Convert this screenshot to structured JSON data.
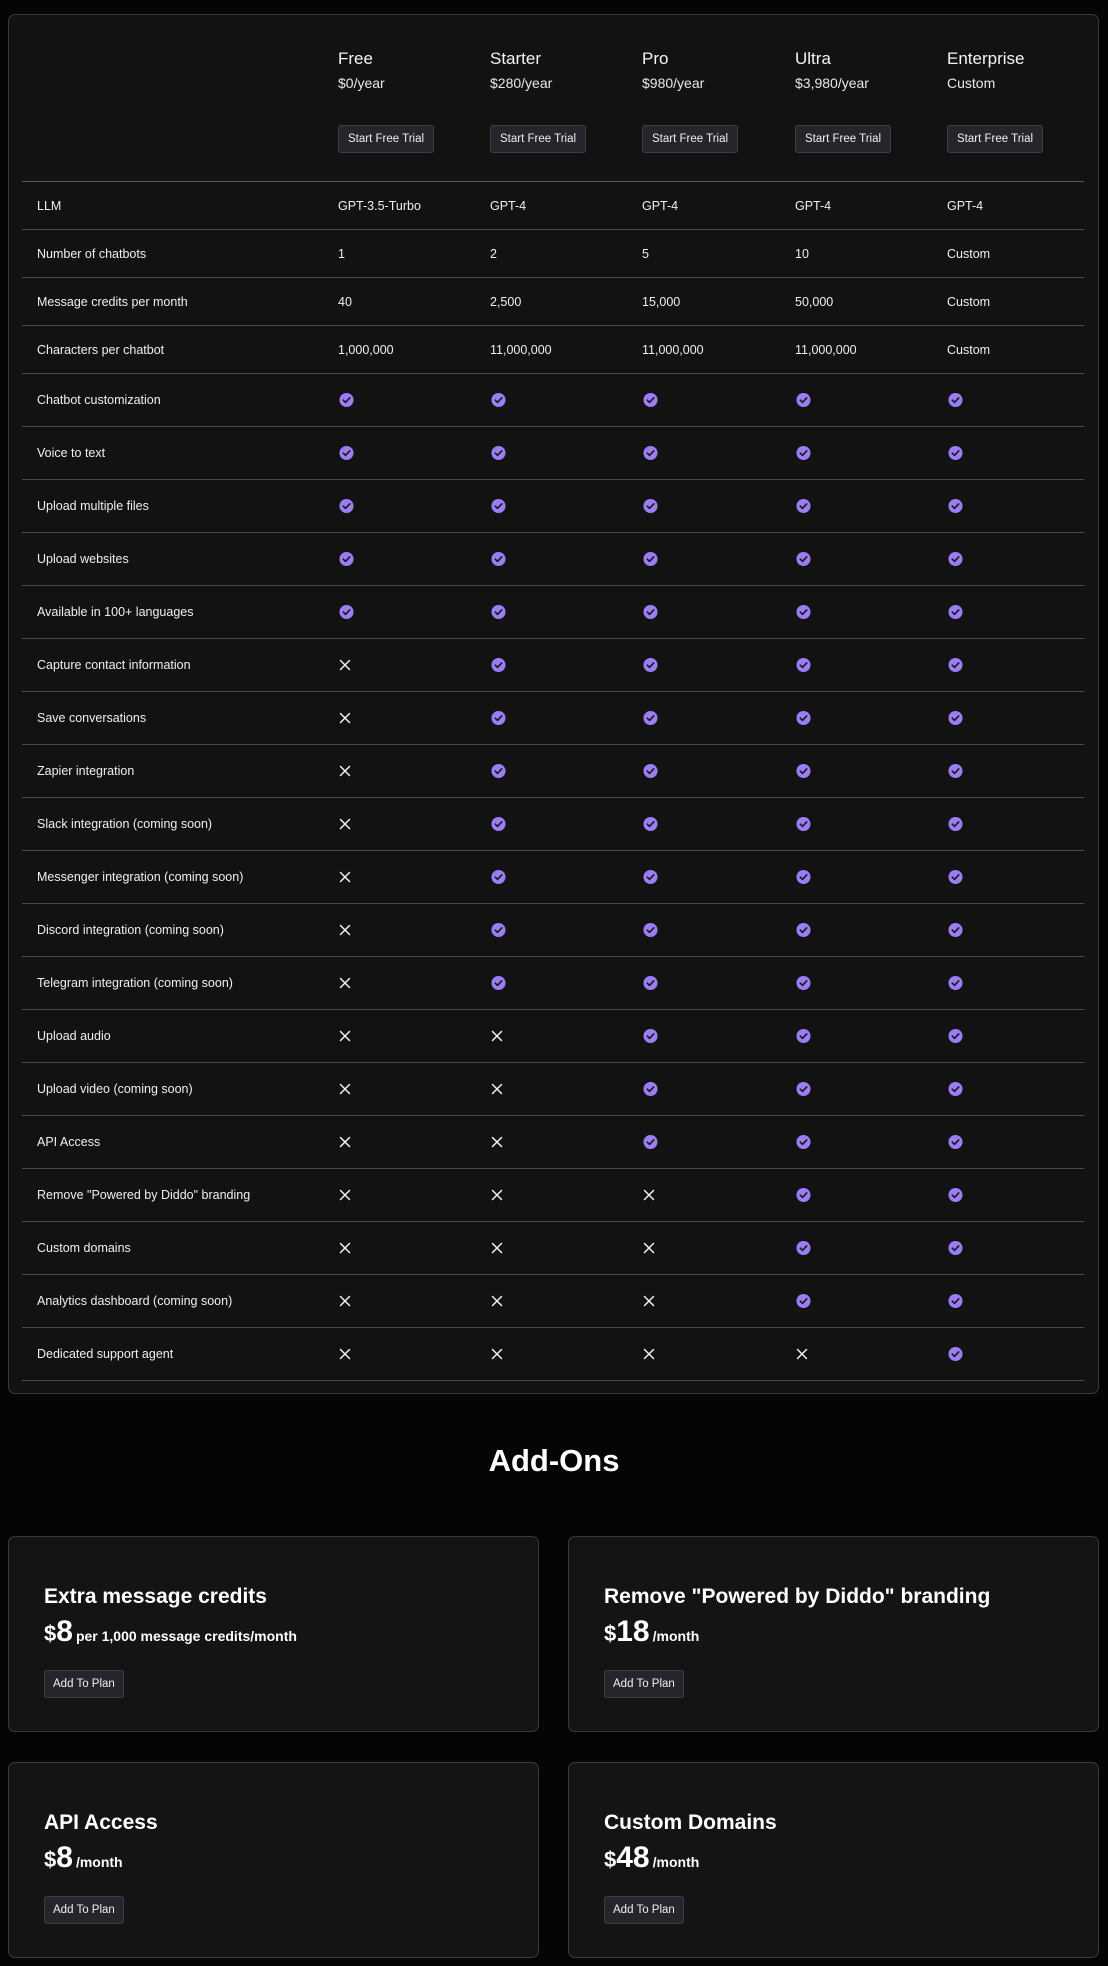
{
  "colors": {
    "check": "#9b7ef5",
    "background": "#050505",
    "card": "#121212"
  },
  "plans": [
    {
      "name": "Free",
      "price": "$0/year",
      "cta": "Start Free Trial"
    },
    {
      "name": "Starter",
      "price": "$280/year",
      "cta": "Start Free Trial"
    },
    {
      "name": "Pro",
      "price": "$980/year",
      "cta": "Start Free Trial"
    },
    {
      "name": "Ultra",
      "price": "$3,980/year",
      "cta": "Start Free Trial"
    },
    {
      "name": "Enterprise",
      "price": "Custom",
      "cta": "Start Free Trial"
    }
  ],
  "features": [
    {
      "label": "LLM",
      "values": [
        "GPT-3.5-Turbo",
        "GPT-4",
        "GPT-4",
        "GPT-4",
        "GPT-4"
      ]
    },
    {
      "label": "Number of chatbots",
      "values": [
        "1",
        "2",
        "5",
        "10",
        "Custom"
      ]
    },
    {
      "label": "Message credits per month",
      "values": [
        "40",
        "2,500",
        "15,000",
        "50,000",
        "Custom"
      ]
    },
    {
      "label": "Characters per chatbot",
      "values": [
        "1,000,000",
        "11,000,000",
        "11,000,000",
        "11,000,000",
        "Custom"
      ]
    },
    {
      "label": "Chatbot customization",
      "values": [
        true,
        true,
        true,
        true,
        true
      ]
    },
    {
      "label": "Voice to text",
      "values": [
        true,
        true,
        true,
        true,
        true
      ]
    },
    {
      "label": "Upload multiple files",
      "values": [
        true,
        true,
        true,
        true,
        true
      ]
    },
    {
      "label": "Upload websites",
      "values": [
        true,
        true,
        true,
        true,
        true
      ]
    },
    {
      "label": "Available in 100+ languages",
      "values": [
        true,
        true,
        true,
        true,
        true
      ]
    },
    {
      "label": "Capture contact information",
      "values": [
        false,
        true,
        true,
        true,
        true
      ]
    },
    {
      "label": "Save conversations",
      "values": [
        false,
        true,
        true,
        true,
        true
      ]
    },
    {
      "label": "Zapier integration",
      "values": [
        false,
        true,
        true,
        true,
        true
      ]
    },
    {
      "label": "Slack integration (coming soon)",
      "values": [
        false,
        true,
        true,
        true,
        true
      ]
    },
    {
      "label": "Messenger integration (coming soon)",
      "values": [
        false,
        true,
        true,
        true,
        true
      ]
    },
    {
      "label": "Discord integration (coming soon)",
      "values": [
        false,
        true,
        true,
        true,
        true
      ]
    },
    {
      "label": "Telegram integration (coming soon)",
      "values": [
        false,
        true,
        true,
        true,
        true
      ]
    },
    {
      "label": "Upload audio",
      "values": [
        false,
        false,
        true,
        true,
        true
      ]
    },
    {
      "label": "Upload video (coming soon)",
      "values": [
        false,
        false,
        true,
        true,
        true
      ]
    },
    {
      "label": "API Access",
      "values": [
        false,
        false,
        true,
        true,
        true
      ]
    },
    {
      "label": "Remove \"Powered by Diddo\" branding",
      "values": [
        false,
        false,
        false,
        true,
        true
      ]
    },
    {
      "label": "Custom domains",
      "values": [
        false,
        false,
        false,
        true,
        true
      ]
    },
    {
      "label": "Analytics dashboard (coming soon)",
      "values": [
        false,
        false,
        false,
        true,
        true
      ]
    },
    {
      "label": "Dedicated support agent",
      "values": [
        false,
        false,
        false,
        false,
        true
      ]
    }
  ],
  "addons": {
    "title": "Add-Ons",
    "items": [
      {
        "name": "Extra message credits",
        "currency": "$",
        "amount": "8",
        "unit": "per 1,000 message credits/month",
        "cta": "Add To Plan"
      },
      {
        "name": "Remove \"Powered by Diddo\" branding",
        "currency": "$",
        "amount": "18",
        "unit": "/month",
        "cta": "Add To Plan"
      },
      {
        "name": "API Access",
        "currency": "$",
        "amount": "8",
        "unit": "/month",
        "cta": "Add To Plan"
      },
      {
        "name": "Custom Domains",
        "currency": "$",
        "amount": "48",
        "unit": "/month",
        "cta": "Add To Plan"
      }
    ]
  }
}
